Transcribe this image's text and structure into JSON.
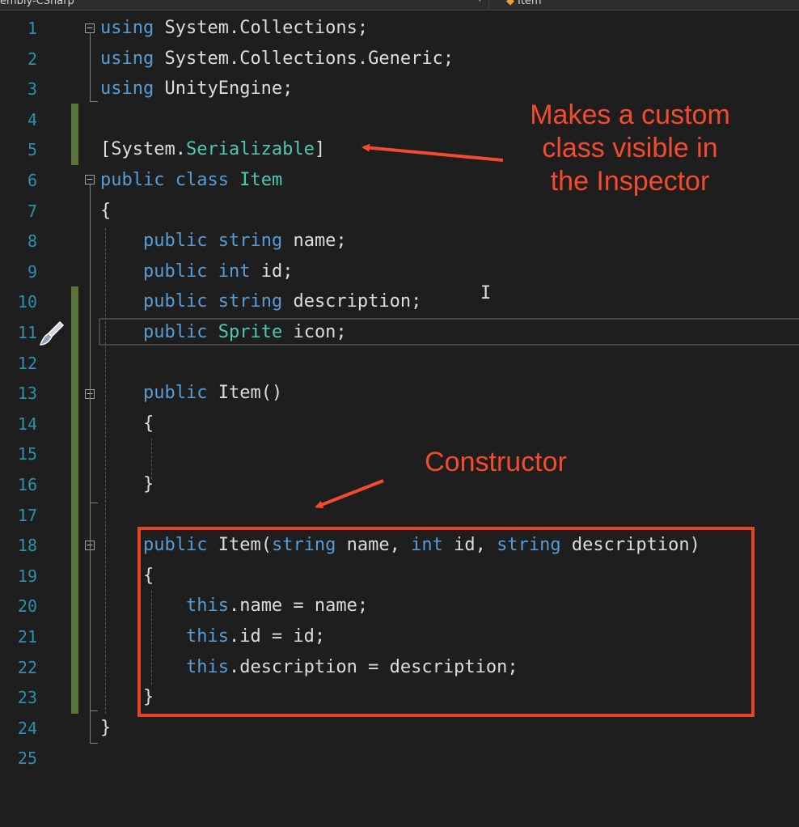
{
  "toolbar": {
    "project_dropdown": "embly-CSharp",
    "member_dropdown": "Item"
  },
  "editor": {
    "lines": [
      {
        "n": "1",
        "tokens": [
          [
            "kw",
            "using"
          ],
          [
            "plain",
            " System.Collections;"
          ]
        ]
      },
      {
        "n": "2",
        "tokens": [
          [
            "kw",
            "using"
          ],
          [
            "plain",
            " System.Collections.Generic;"
          ]
        ]
      },
      {
        "n": "3",
        "tokens": [
          [
            "kw",
            "using"
          ],
          [
            "plain",
            " UnityEngine;"
          ]
        ]
      },
      {
        "n": "4",
        "tokens": []
      },
      {
        "n": "5",
        "tokens": [
          [
            "plain",
            "[System."
          ],
          [
            "ty",
            "Serializable"
          ],
          [
            "plain",
            "]"
          ]
        ]
      },
      {
        "n": "6",
        "tokens": [
          [
            "kw",
            "public"
          ],
          [
            "plain",
            " "
          ],
          [
            "kw",
            "class"
          ],
          [
            "plain",
            " "
          ],
          [
            "ty",
            "Item"
          ]
        ]
      },
      {
        "n": "7",
        "tokens": [
          [
            "plain",
            "{"
          ]
        ]
      },
      {
        "n": "8",
        "tokens": [
          [
            "plain",
            "    "
          ],
          [
            "kw",
            "public"
          ],
          [
            "plain",
            " "
          ],
          [
            "kw",
            "string"
          ],
          [
            "plain",
            " name;"
          ]
        ]
      },
      {
        "n": "9",
        "tokens": [
          [
            "plain",
            "    "
          ],
          [
            "kw",
            "public"
          ],
          [
            "plain",
            " "
          ],
          [
            "kw",
            "int"
          ],
          [
            "plain",
            " id;"
          ]
        ]
      },
      {
        "n": "10",
        "tokens": [
          [
            "plain",
            "    "
          ],
          [
            "kw",
            "public"
          ],
          [
            "plain",
            " "
          ],
          [
            "kw",
            "string"
          ],
          [
            "plain",
            " description;"
          ]
        ]
      },
      {
        "n": "11",
        "tokens": [
          [
            "plain",
            "    "
          ],
          [
            "kw",
            "public"
          ],
          [
            "plain",
            " "
          ],
          [
            "ty",
            "Sprite"
          ],
          [
            "plain",
            " icon;"
          ]
        ]
      },
      {
        "n": "12",
        "tokens": []
      },
      {
        "n": "13",
        "tokens": [
          [
            "plain",
            "    "
          ],
          [
            "kw",
            "public"
          ],
          [
            "plain",
            " Item()"
          ]
        ]
      },
      {
        "n": "14",
        "tokens": [
          [
            "plain",
            "    {"
          ]
        ]
      },
      {
        "n": "15",
        "tokens": []
      },
      {
        "n": "16",
        "tokens": [
          [
            "plain",
            "    }"
          ]
        ]
      },
      {
        "n": "17",
        "tokens": []
      },
      {
        "n": "18",
        "tokens": [
          [
            "plain",
            "    "
          ],
          [
            "kw",
            "public"
          ],
          [
            "plain",
            " Item("
          ],
          [
            "kw",
            "string"
          ],
          [
            "plain",
            " name, "
          ],
          [
            "kw",
            "int"
          ],
          [
            "plain",
            " id, "
          ],
          [
            "kw",
            "string"
          ],
          [
            "plain",
            " description)"
          ]
        ]
      },
      {
        "n": "19",
        "tokens": [
          [
            "plain",
            "    {"
          ]
        ]
      },
      {
        "n": "20",
        "tokens": [
          [
            "plain",
            "        "
          ],
          [
            "kw",
            "this"
          ],
          [
            "plain",
            ".name = name;"
          ]
        ]
      },
      {
        "n": "21",
        "tokens": [
          [
            "plain",
            "        "
          ],
          [
            "kw",
            "this"
          ],
          [
            "plain",
            ".id = id;"
          ]
        ]
      },
      {
        "n": "22",
        "tokens": [
          [
            "plain",
            "        "
          ],
          [
            "kw",
            "this"
          ],
          [
            "plain",
            ".description = description;"
          ]
        ]
      },
      {
        "n": "23",
        "tokens": [
          [
            "plain",
            "    }"
          ]
        ]
      },
      {
        "n": "24",
        "tokens": [
          [
            "plain",
            "}"
          ]
        ]
      },
      {
        "n": "25",
        "tokens": []
      }
    ]
  },
  "annotations": {
    "inspector": [
      "Makes a custom",
      "class visible in",
      "the Inspector"
    ],
    "constructor": "Constructor"
  },
  "colors": {
    "annotation": "#f44a2e",
    "keyword": "#569cd6",
    "type": "#4ec9b0",
    "line_number": "#2b91af",
    "change_bar": "#57743a",
    "background": "#1e1e1e"
  }
}
